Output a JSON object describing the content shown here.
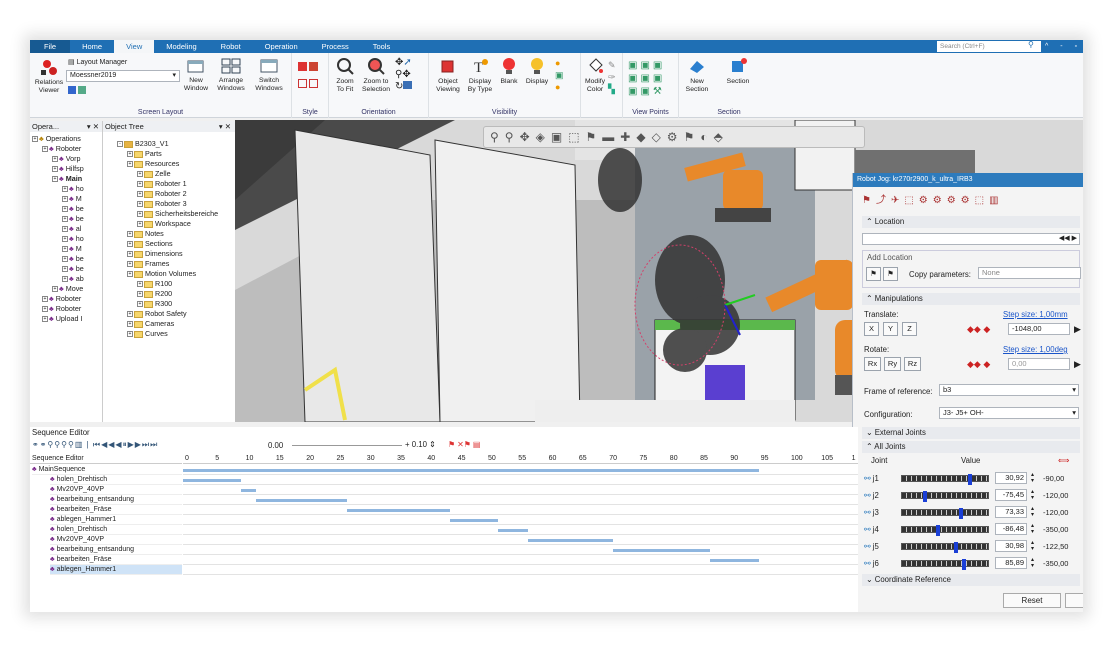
{
  "menu": {
    "tabs": [
      "File",
      "Home",
      "View",
      "Modeling",
      "Robot",
      "Operation",
      "Process",
      "Tools"
    ],
    "active": "View",
    "search_placeholder": "Search (Ctrl+F)"
  },
  "ribbon": {
    "layout_manager": "Layout Manager",
    "layout_value": "Moessner2019",
    "relations": "Relations",
    "viewer": "Viewer",
    "new_window": "New\nWindow",
    "arrange": "Arrange\nWindows",
    "switch": "Switch\nWindows",
    "zoom_fit": "Zoom\nTo Fit",
    "zoom_sel": "Zoom to\nSelection",
    "obj_view": "Object\nViewing",
    "disp_type": "Display\nBy Type",
    "blank": "Blank",
    "display": "Display",
    "modify_color": "Modify\nColor",
    "new_section": "New\nSection",
    "section": "Section",
    "groups": [
      "Screen Layout",
      "Style",
      "Orientation",
      "Visibility",
      "View Points",
      "Section"
    ]
  },
  "ops_panel": {
    "title": "Opera...",
    "items": [
      "Operations",
      "Roboter",
      "Vorp",
      "Hilfsp",
      "Main",
      "ho",
      "M",
      "be",
      "be",
      "al",
      "ho",
      "M",
      "be",
      "be",
      "ab",
      "Move",
      "Roboter",
      "Roboter",
      "Upload I"
    ]
  },
  "tree_panel": {
    "title": "Object Tree",
    "root": "B2303_V1",
    "items": [
      "Parts",
      "Resources",
      "Zelle",
      "Roboter 1",
      "Roboter 2",
      "Roboter 3",
      "Sicherheitsbereiche",
      "Workspace",
      "Notes",
      "Sections",
      "Dimensions",
      "Frames",
      "Motion Volumes",
      "R100",
      "R200",
      "R300",
      "Robot Safety",
      "Cameras",
      "Curves"
    ]
  },
  "seq": {
    "title": "Sequence Editor",
    "time": "0.00",
    "step": "0.10",
    "col_header": "Sequence Editor",
    "ticks": [
      "0",
      "5",
      "10",
      "15",
      "20",
      "25",
      "30",
      "35",
      "40",
      "45",
      "50",
      "55",
      "60",
      "65",
      "70",
      "75",
      "80",
      "85",
      "90",
      "95",
      "100",
      "105",
      "1"
    ],
    "root": "MainSequence",
    "rows": [
      "holen_Drehtisch",
      "Mv20VP_40VP",
      "bearbeitung_entsandung",
      "bearbeiten_Fräse",
      "ablegen_Hammer1",
      "holen_Drehtisch",
      "Mv20VP_40VP",
      "bearbeitung_entsandung",
      "bearbeiten_Fräse",
      "ablegen_Hammer1"
    ],
    "bars": [
      [
        0,
        95
      ],
      [
        0,
        9.5
      ],
      [
        9.5,
        12
      ],
      [
        12,
        27
      ],
      [
        27,
        44
      ],
      [
        44,
        52
      ],
      [
        52,
        57
      ],
      [
        57,
        71
      ],
      [
        71,
        87
      ],
      [
        87,
        95
      ]
    ]
  },
  "jog": {
    "title": "Robot Jog: kr270r2900_k_ultra_IRB3",
    "location": "Location",
    "add_location": "Add Location",
    "copy_params": "Copy parameters:",
    "copy_value": "None",
    "manip": "Manipulations",
    "translate": "Translate:",
    "step1": "Step size: 1,00mm",
    "t_value": "-1048,00",
    "rotate": "Rotate:",
    "step2": "Step size: 1,00deg",
    "r_value": "0,00",
    "frame_lbl": "Frame of reference:",
    "frame_val": "b3",
    "config_lbl": "Configuration:",
    "config_val": "J3- J5+ OH-",
    "ext": "External Joints",
    "all": "All Joints",
    "col_joint": "Joint",
    "col_value": "Value",
    "axes_t": [
      "X",
      "Y",
      "Z"
    ],
    "axes_r": [
      "Rx",
      "Ry",
      "Rz"
    ],
    "joints": [
      {
        "name": "j1",
        "value": "30,92",
        "limit": "-90,00",
        "pos": 0.78
      },
      {
        "name": "j2",
        "value": "-75,45",
        "limit": "-120,00",
        "pos": 0.25
      },
      {
        "name": "j3",
        "value": "73,33",
        "limit": "-120,00",
        "pos": 0.68
      },
      {
        "name": "j4",
        "value": "-86,48",
        "limit": "-350,00",
        "pos": 0.4
      },
      {
        "name": "j5",
        "value": "30,98",
        "limit": "-122,50",
        "pos": 0.62
      },
      {
        "name": "j6",
        "value": "85,89",
        "limit": "-350,00",
        "pos": 0.72
      }
    ],
    "coord": "Coordinate Reference",
    "reset": "Reset"
  },
  "colors": {
    "menubar": "#1f6fb4",
    "jog_title": "#2d7bbd",
    "robot": "#e8892a"
  }
}
